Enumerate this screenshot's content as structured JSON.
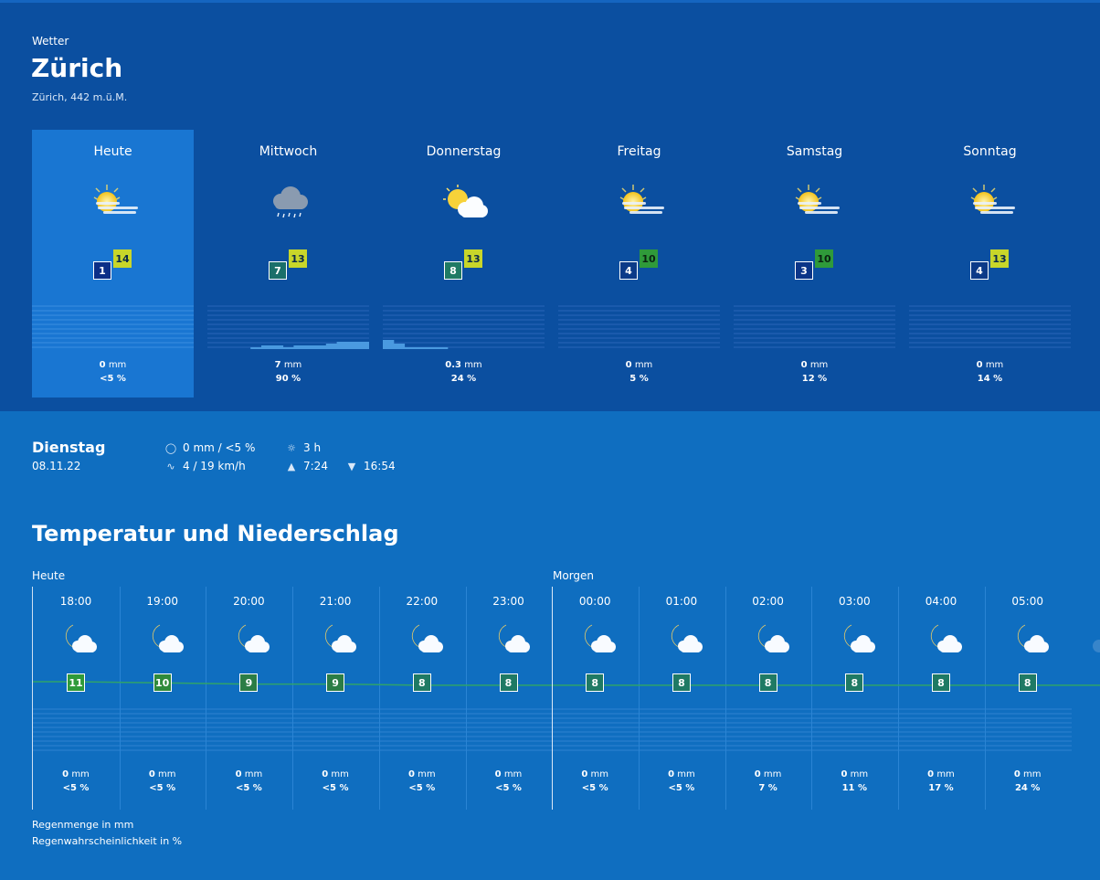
{
  "header": {
    "kicker": "Wetter",
    "city": "Zürich",
    "location": "Zürich, 442 m.ü.M."
  },
  "days": [
    {
      "name": "Heute",
      "icon": "sun-cloud-icon",
      "min": "1",
      "max": "14",
      "max_color": "#c8d62a",
      "min_color": "#0b2f88",
      "rain_mm": "0",
      "rain_pct": "<5 %",
      "bars": []
    },
    {
      "name": "Mittwoch",
      "icon": "rain-cloud-icon",
      "min": "7",
      "max": "13",
      "max_color": "#c8d62a",
      "min_color": "#1a6f6a",
      "rain_mm": "7",
      "rain_pct": "90 %",
      "bars": [
        0,
        0,
        0,
        0,
        1,
        2,
        2,
        1,
        2,
        2,
        2,
        3,
        4,
        4,
        4
      ]
    },
    {
      "name": "Donnerstag",
      "icon": "sun-cloud-icon",
      "min": "8",
      "max": "13",
      "max_color": "#c8d62a",
      "min_color": "#1f7a64",
      "rain_mm": "0.3",
      "rain_pct": "24 %",
      "bars": [
        5,
        3,
        1,
        1,
        1,
        1,
        0,
        0,
        0,
        0,
        0,
        0,
        0,
        0,
        0
      ]
    },
    {
      "name": "Freitag",
      "icon": "sun-cloud-icon",
      "min": "4",
      "max": "10",
      "max_color": "#2f9a3a",
      "min_color": "#0b3a88",
      "rain_mm": "0",
      "rain_pct": "5 %",
      "bars": []
    },
    {
      "name": "Samstag",
      "icon": "sun-cloud-icon",
      "min": "3",
      "max": "10",
      "max_color": "#2f9a3a",
      "min_color": "#0b3588",
      "rain_mm": "0",
      "rain_pct": "12 %",
      "bars": []
    },
    {
      "name": "Sonntag",
      "icon": "sun-cloud-icon",
      "min": "4",
      "max": "13",
      "max_color": "#c8d62a",
      "min_color": "#0b3a88",
      "rain_mm": "0",
      "rain_pct": "14 %",
      "bars": []
    }
  ],
  "mm_unit": "mm",
  "detail": {
    "day": "Dienstag",
    "date": "08.11.22",
    "rain": "0 mm / <5 %",
    "wind": "4 / 19 km/h",
    "sunshine": "3 h",
    "sunrise": "7:24",
    "sunset": "16:54"
  },
  "section_title": "Temperatur und Niederschlag",
  "today_label": "Heute",
  "tomorrow_label": "Morgen",
  "hours": [
    {
      "time": "18:00",
      "temp": "11",
      "color": "#2f9a3a",
      "mm": "0",
      "pct": "<5 %"
    },
    {
      "time": "19:00",
      "temp": "10",
      "color": "#2f8a3a",
      "mm": "0",
      "pct": "<5 %"
    },
    {
      "time": "20:00",
      "temp": "9",
      "color": "#2b7d45",
      "mm": "0",
      "pct": "<5 %"
    },
    {
      "time": "21:00",
      "temp": "9",
      "color": "#2b7d45",
      "mm": "0",
      "pct": "<5 %"
    },
    {
      "time": "22:00",
      "temp": "8",
      "color": "#1f7a64",
      "mm": "0",
      "pct": "<5 %"
    },
    {
      "time": "23:00",
      "temp": "8",
      "color": "#1f7a64",
      "mm": "0",
      "pct": "<5 %"
    },
    {
      "time": "00:00",
      "temp": "8",
      "color": "#1f7a64",
      "mm": "0",
      "pct": "<5 %"
    },
    {
      "time": "01:00",
      "temp": "8",
      "color": "#1f7a64",
      "mm": "0",
      "pct": "<5 %"
    },
    {
      "time": "02:00",
      "temp": "8",
      "color": "#1f7a64",
      "mm": "0",
      "pct": "7 %"
    },
    {
      "time": "03:00",
      "temp": "8",
      "color": "#1f7a64",
      "mm": "0",
      "pct": "11 %"
    },
    {
      "time": "04:00",
      "temp": "8",
      "color": "#1f7a64",
      "mm": "0",
      "pct": "17 %"
    },
    {
      "time": "05:00",
      "temp": "8",
      "color": "#1f7a64",
      "mm": "0",
      "pct": "24 %"
    }
  ],
  "legend": {
    "amount": "Regenmenge in mm",
    "probability": "Regenwahrscheinlichkeit in %"
  },
  "colors": {
    "top_bg": "#0b4fa0",
    "page_bg": "#0f6ec0",
    "selected": "#1976d2",
    "rain_bar": "#4a9ae0",
    "temp_line": "#2fa36a"
  }
}
